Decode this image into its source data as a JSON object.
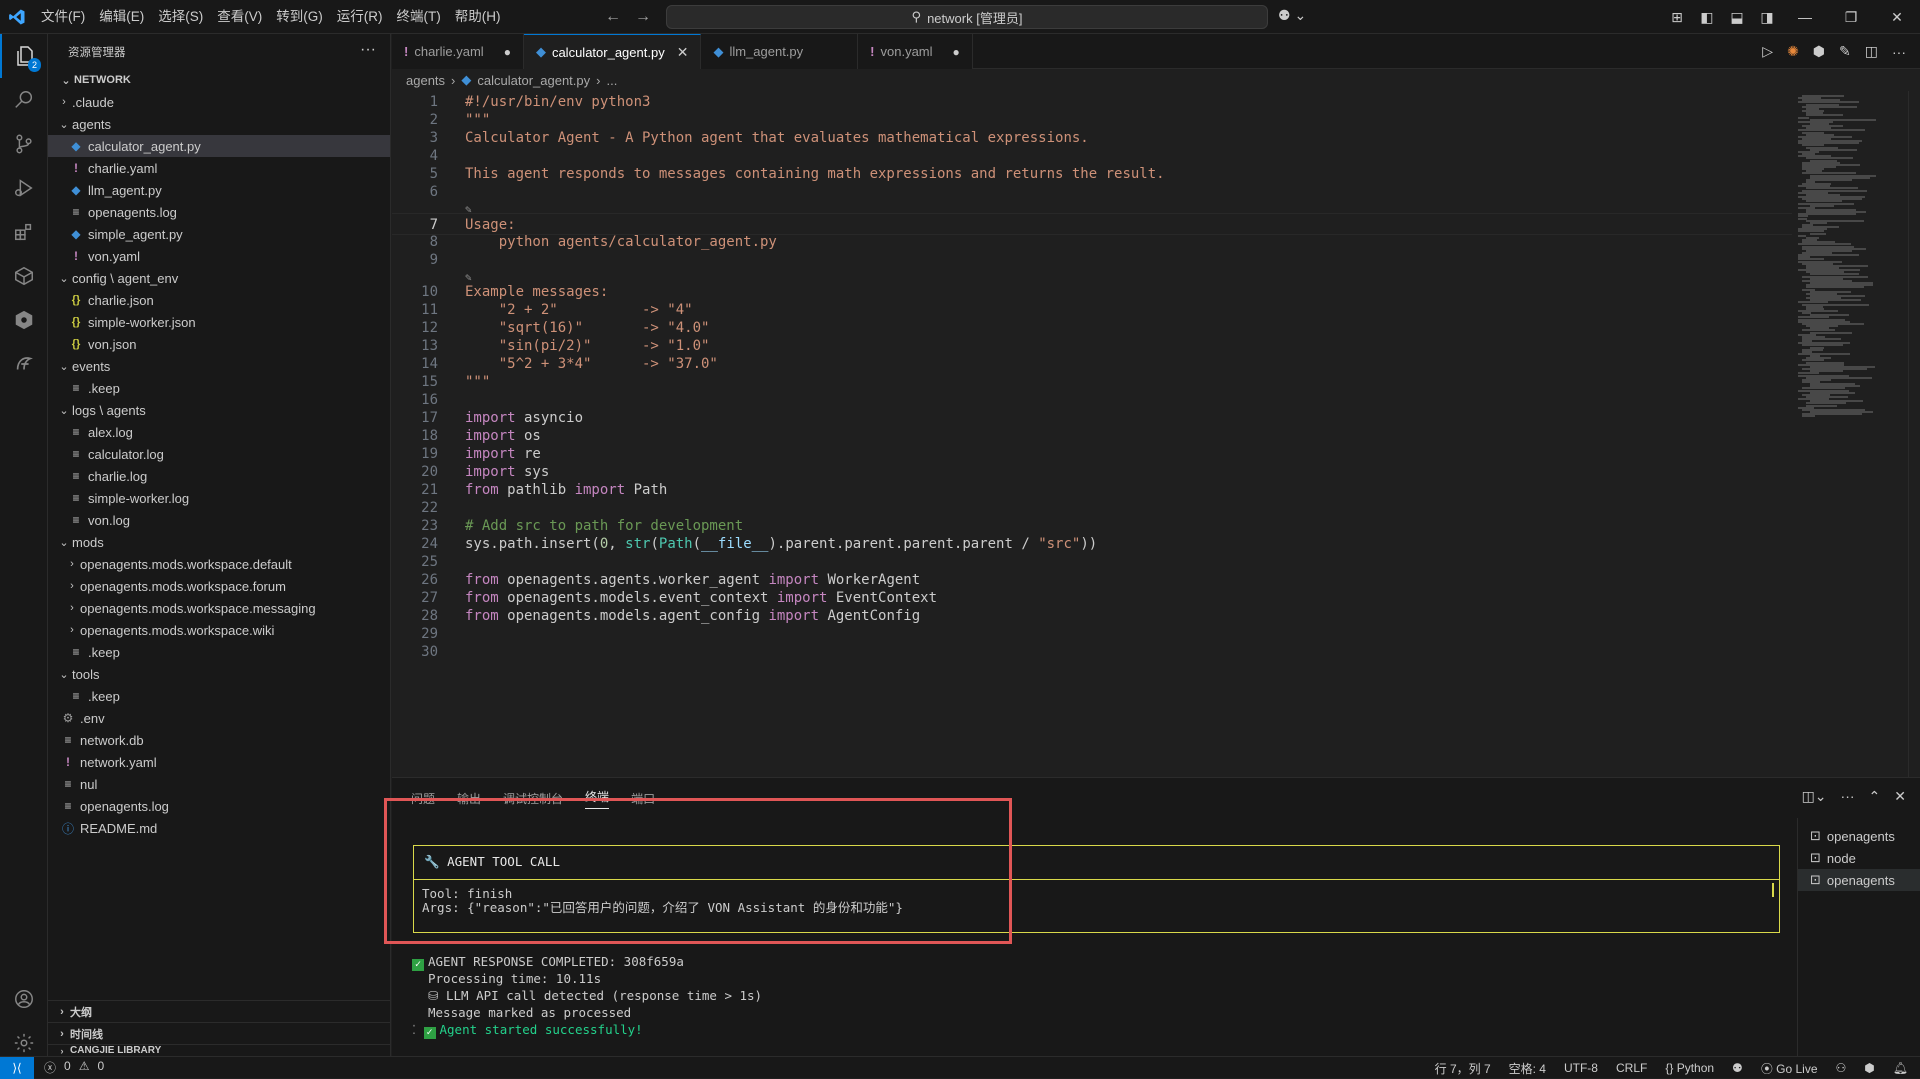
{
  "titlebar": {
    "menus": [
      "文件(F)",
      "编辑(E)",
      "选择(S)",
      "查看(V)",
      "转到(G)",
      "运行(R)",
      "终端(T)",
      "帮助(H)"
    ],
    "search_text": "network [管理员]"
  },
  "activitybar": {
    "explorer_badge": "2"
  },
  "sidebar": {
    "title": "资源管理器",
    "root": "NETWORK",
    "tree": [
      {
        "label": ".claude",
        "depth": 1,
        "kind": "folder-closed"
      },
      {
        "label": "agents",
        "depth": 1,
        "kind": "folder-open"
      },
      {
        "label": "calculator_agent.py",
        "depth": 2,
        "kind": "py",
        "selected": true
      },
      {
        "label": "charlie.yaml",
        "depth": 2,
        "kind": "yaml"
      },
      {
        "label": "llm_agent.py",
        "depth": 2,
        "kind": "py"
      },
      {
        "label": "openagents.log",
        "depth": 2,
        "kind": "log"
      },
      {
        "label": "simple_agent.py",
        "depth": 2,
        "kind": "py"
      },
      {
        "label": "von.yaml",
        "depth": 2,
        "kind": "yaml"
      },
      {
        "label": "config \\ agent_env",
        "depth": 1,
        "kind": "folder-open"
      },
      {
        "label": "charlie.json",
        "depth": 2,
        "kind": "json"
      },
      {
        "label": "simple-worker.json",
        "depth": 2,
        "kind": "json"
      },
      {
        "label": "von.json",
        "depth": 2,
        "kind": "json"
      },
      {
        "label": "events",
        "depth": 1,
        "kind": "folder-open"
      },
      {
        "label": ".keep",
        "depth": 2,
        "kind": "log"
      },
      {
        "label": "logs \\ agents",
        "depth": 1,
        "kind": "folder-open"
      },
      {
        "label": "alex.log",
        "depth": 2,
        "kind": "log"
      },
      {
        "label": "calculator.log",
        "depth": 2,
        "kind": "log"
      },
      {
        "label": "charlie.log",
        "depth": 2,
        "kind": "log"
      },
      {
        "label": "simple-worker.log",
        "depth": 2,
        "kind": "log"
      },
      {
        "label": "von.log",
        "depth": 2,
        "kind": "log"
      },
      {
        "label": "mods",
        "depth": 1,
        "kind": "folder-open"
      },
      {
        "label": "openagents.mods.workspace.default",
        "depth": 2,
        "kind": "folder-closed"
      },
      {
        "label": "openagents.mods.workspace.forum",
        "depth": 2,
        "kind": "folder-closed"
      },
      {
        "label": "openagents.mods.workspace.messaging",
        "depth": 2,
        "kind": "folder-closed"
      },
      {
        "label": "openagents.mods.workspace.wiki",
        "depth": 2,
        "kind": "folder-closed"
      },
      {
        "label": ".keep",
        "depth": 2,
        "kind": "log"
      },
      {
        "label": "tools",
        "depth": 1,
        "kind": "folder-open"
      },
      {
        "label": ".keep",
        "depth": 2,
        "kind": "log"
      },
      {
        "label": ".env",
        "depth": 1,
        "kind": "env"
      },
      {
        "label": "network.db",
        "depth": 1,
        "kind": "log"
      },
      {
        "label": "network.yaml",
        "depth": 1,
        "kind": "yaml"
      },
      {
        "label": "nul",
        "depth": 1,
        "kind": "log"
      },
      {
        "label": "openagents.log",
        "depth": 1,
        "kind": "log"
      },
      {
        "label": "README.md",
        "depth": 1,
        "kind": "info"
      }
    ],
    "bottom_sections": [
      "大纲",
      "时间线",
      "CANGJIE LIBRARY"
    ]
  },
  "tabs": [
    {
      "label": "charlie.yaml",
      "kind": "yaml",
      "state": "dirty"
    },
    {
      "label": "calculator_agent.py",
      "kind": "py",
      "state": "active"
    },
    {
      "label": "llm_agent.py",
      "kind": "py",
      "state": ""
    },
    {
      "label": "von.yaml",
      "kind": "yaml",
      "state": "dirty"
    }
  ],
  "breadcrumb": [
    "agents",
    "calculator_agent.py",
    "..."
  ],
  "editor": {
    "lines": [
      {
        "n": "1",
        "tokens": [
          {
            "t": "#!/usr/bin/env python3",
            "c": "str"
          }
        ]
      },
      {
        "n": "2",
        "tokens": [
          {
            "t": "\"\"\"",
            "c": "str"
          }
        ]
      },
      {
        "n": "3",
        "tokens": [
          {
            "t": "Calculator Agent - A Python agent that evaluates mathematical expressions.",
            "c": "str"
          }
        ]
      },
      {
        "n": "4",
        "tokens": []
      },
      {
        "n": "5",
        "tokens": [
          {
            "t": "This agent responds to messages containing math expressions and returns the result.",
            "c": "str"
          }
        ]
      },
      {
        "n": "6",
        "tokens": []
      },
      {
        "n": "",
        "lens": "✎"
      },
      {
        "n": "7",
        "tokens": [
          {
            "t": "Usage:",
            "c": "str"
          }
        ],
        "current": true
      },
      {
        "n": "8",
        "tokens": [
          {
            "t": "    python agents/calculator_agent.py",
            "c": "str"
          }
        ]
      },
      {
        "n": "9",
        "tokens": []
      },
      {
        "n": "",
        "lens": "✎"
      },
      {
        "n": "10",
        "tokens": [
          {
            "t": "Example messages:",
            "c": "str"
          }
        ]
      },
      {
        "n": "11",
        "tokens": [
          {
            "t": "    \"2 + 2\"          -> \"4\"",
            "c": "str"
          }
        ]
      },
      {
        "n": "12",
        "tokens": [
          {
            "t": "    \"sqrt(16)\"       -> \"4.0\"",
            "c": "str"
          }
        ]
      },
      {
        "n": "13",
        "tokens": [
          {
            "t": "    \"sin(pi/2)\"      -> \"1.0\"",
            "c": "str"
          }
        ]
      },
      {
        "n": "14",
        "tokens": [
          {
            "t": "    \"5^2 + 3*4\"      -> \"37.0\"",
            "c": "str"
          }
        ]
      },
      {
        "n": "15",
        "tokens": [
          {
            "t": "\"\"\"",
            "c": "str"
          }
        ]
      },
      {
        "n": "16",
        "tokens": []
      },
      {
        "n": "17",
        "tokens": [
          {
            "t": "import",
            "c": "kw"
          },
          {
            "t": " asyncio",
            "c": "txt"
          }
        ]
      },
      {
        "n": "18",
        "tokens": [
          {
            "t": "import",
            "c": "kw"
          },
          {
            "t": " os",
            "c": "txt"
          }
        ]
      },
      {
        "n": "19",
        "tokens": [
          {
            "t": "import",
            "c": "kw"
          },
          {
            "t": " re",
            "c": "txt"
          }
        ]
      },
      {
        "n": "20",
        "tokens": [
          {
            "t": "import",
            "c": "kw"
          },
          {
            "t": " sys",
            "c": "txt"
          }
        ]
      },
      {
        "n": "21",
        "tokens": [
          {
            "t": "from",
            "c": "kw"
          },
          {
            "t": " pathlib ",
            "c": "txt"
          },
          {
            "t": "import",
            "c": "kw"
          },
          {
            "t": " Path",
            "c": "txt"
          }
        ]
      },
      {
        "n": "22",
        "tokens": []
      },
      {
        "n": "23",
        "tokens": [
          {
            "t": "# Add src to path for development",
            "c": "cm"
          }
        ]
      },
      {
        "n": "24",
        "tokens": [
          {
            "t": "sys.path.insert(",
            "c": "txt"
          },
          {
            "t": "0",
            "c": "num"
          },
          {
            "t": ", ",
            "c": "txt"
          },
          {
            "t": "str",
            "c": "cls"
          },
          {
            "t": "(",
            "c": "txt"
          },
          {
            "t": "Path",
            "c": "cls"
          },
          {
            "t": "(",
            "c": "txt"
          },
          {
            "t": "__file__",
            "c": "var"
          },
          {
            "t": ").parent.parent.parent.parent / ",
            "c": "txt"
          },
          {
            "t": "\"src\"",
            "c": "str"
          },
          {
            "t": "))",
            "c": "txt"
          }
        ]
      },
      {
        "n": "25",
        "tokens": []
      },
      {
        "n": "26",
        "tokens": [
          {
            "t": "from",
            "c": "kw"
          },
          {
            "t": " openagents.agents.worker_agent ",
            "c": "txt"
          },
          {
            "t": "import",
            "c": "kw"
          },
          {
            "t": " WorkerAgent",
            "c": "txt"
          }
        ]
      },
      {
        "n": "27",
        "tokens": [
          {
            "t": "from",
            "c": "kw"
          },
          {
            "t": " openagents.models.event_context ",
            "c": "txt"
          },
          {
            "t": "import",
            "c": "kw"
          },
          {
            "t": " EventContext",
            "c": "txt"
          }
        ]
      },
      {
        "n": "28",
        "tokens": [
          {
            "t": "from",
            "c": "kw"
          },
          {
            "t": " openagents.models.agent_config ",
            "c": "txt"
          },
          {
            "t": "import",
            "c": "kw"
          },
          {
            "t": " AgentConfig",
            "c": "txt"
          }
        ]
      },
      {
        "n": "29",
        "tokens": []
      },
      {
        "n": "30",
        "tokens": []
      }
    ]
  },
  "panel": {
    "tabs": [
      "问题",
      "输出",
      "调试控制台",
      "终端",
      "端口"
    ],
    "active_tab": "终端",
    "terminal": {
      "tool_box_title": "🔧 AGENT TOOL CALL",
      "tool_line": "Tool: finish",
      "args_line": "Args: {\"reason\":\"已回答用户的问题，介绍了 VON Assistant 的身份和功能\"}",
      "completed_line": "AGENT RESPONSE COMPLETED: 308f659a",
      "processing_line": "Processing time: 10.11s",
      "llm_line": "LLM API call detected (response time > 1s)",
      "marked_line": "Message marked as processed",
      "started_line": "Agent started successfully!"
    },
    "terminal_list": [
      "openagents",
      "node",
      "openagents"
    ]
  },
  "statusbar": {
    "errors": "0",
    "warnings": "0",
    "position": "行 7，列 7",
    "spaces": "空格: 4",
    "encoding": "UTF-8",
    "eol": "CRLF",
    "language": "Python",
    "golive": "Go Live"
  },
  "colors": {
    "accent": "#0078d4",
    "highlight_box": "#e05656",
    "tool_box_border": "#d9d94a"
  }
}
